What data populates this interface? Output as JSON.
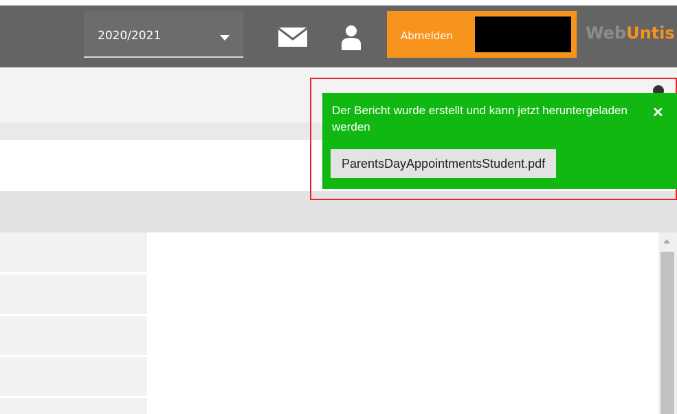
{
  "header": {
    "school_year": "2020/2021",
    "logout_label": "Abmelden",
    "brand_part1": "Web",
    "brand_part2": "Untis",
    "icons": {
      "messages": "envelope-icon",
      "profile": "user-icon",
      "dropdown": "caret-down-icon"
    }
  },
  "notification": {
    "message": "Der Bericht wurde erstellt und kann jetzt heruntergeladen werden",
    "file_name": "ParentsDayAppointmentsStudent.pdf",
    "close_symbol": "✕"
  },
  "colors": {
    "topbar": "#646464",
    "accent": "#f7941d",
    "success": "#11b811",
    "highlight": "#e8202a"
  }
}
